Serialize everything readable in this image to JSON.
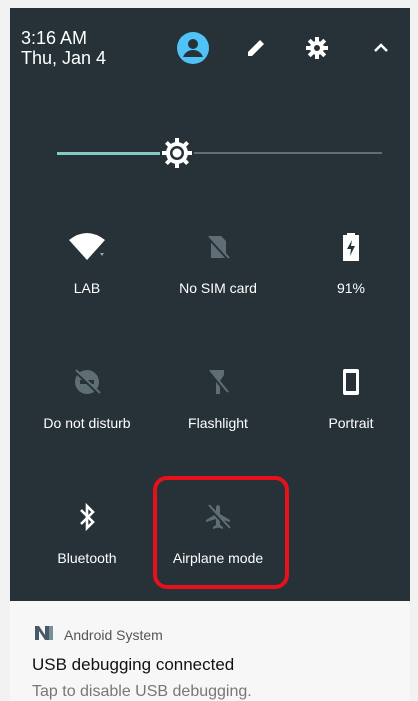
{
  "status": {
    "time": "3:16 AM",
    "date": "Thu, Jan 4"
  },
  "header_icons": [
    "account-icon",
    "edit-icon",
    "settings-icon",
    "collapse-icon"
  ],
  "brightness": {
    "level": 0.37,
    "accent": "#80cbc4"
  },
  "tiles": [
    {
      "label": "LAB",
      "icon": "wifi-icon",
      "active": true
    },
    {
      "label": "No SIM card",
      "icon": "no-sim-icon",
      "active": false
    },
    {
      "label": "91%",
      "icon": "battery-charging-icon",
      "active": true
    },
    {
      "label": "Do not disturb",
      "icon": "do-not-disturb-icon",
      "active": false
    },
    {
      "label": "Flashlight",
      "icon": "flashlight-off-icon",
      "active": false
    },
    {
      "label": "Portrait",
      "icon": "portrait-icon",
      "active": true
    },
    {
      "label": "Bluetooth",
      "icon": "bluetooth-icon",
      "active": true
    },
    {
      "label": "Airplane mode",
      "icon": "airplane-icon",
      "active": false
    }
  ],
  "notification": {
    "app": "Android System",
    "title": "USB debugging connected",
    "text": "Tap to disable USB debugging."
  },
  "colors": {
    "panel": "#263238",
    "highlight": "#e8101a",
    "account": "#4fc3f7"
  }
}
